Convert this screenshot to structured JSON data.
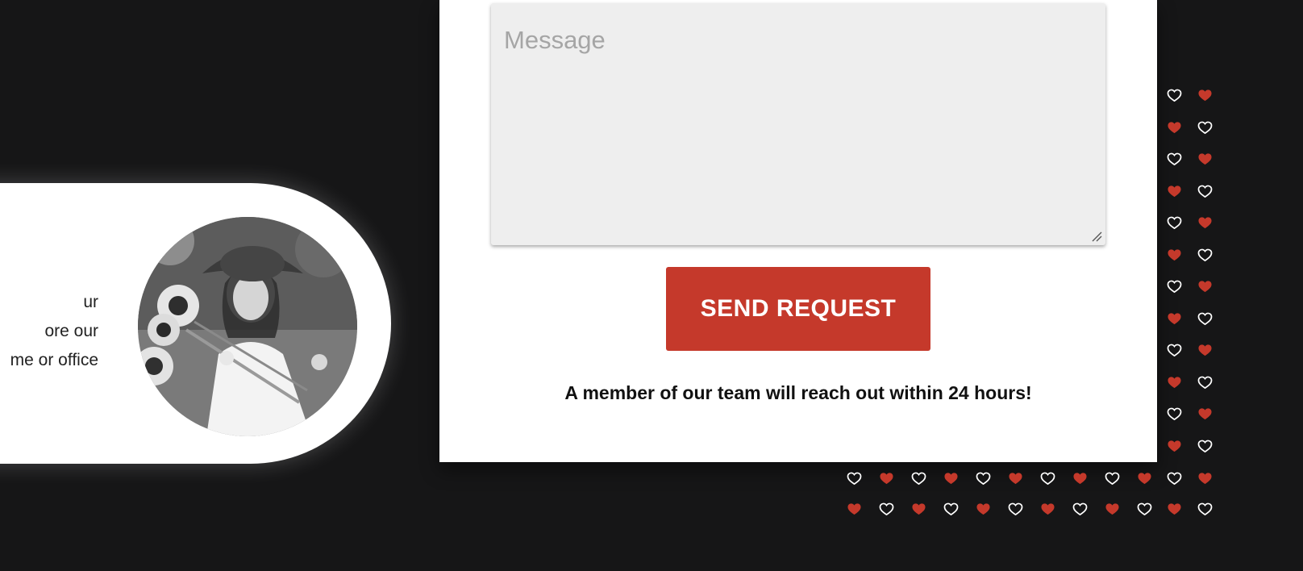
{
  "profile": {
    "text_lines": [
      "ur",
      "ore our",
      "me or office"
    ]
  },
  "form": {
    "message_placeholder": "Message",
    "message_value": "",
    "send_label": "SEND REQUEST",
    "note": "A member of our team will reach out within 24 hours!"
  },
  "colors": {
    "background": "#161617",
    "accent": "#c5392b",
    "field_bg": "#eeeeee"
  },
  "icons": {
    "heart": "heart-icon"
  }
}
